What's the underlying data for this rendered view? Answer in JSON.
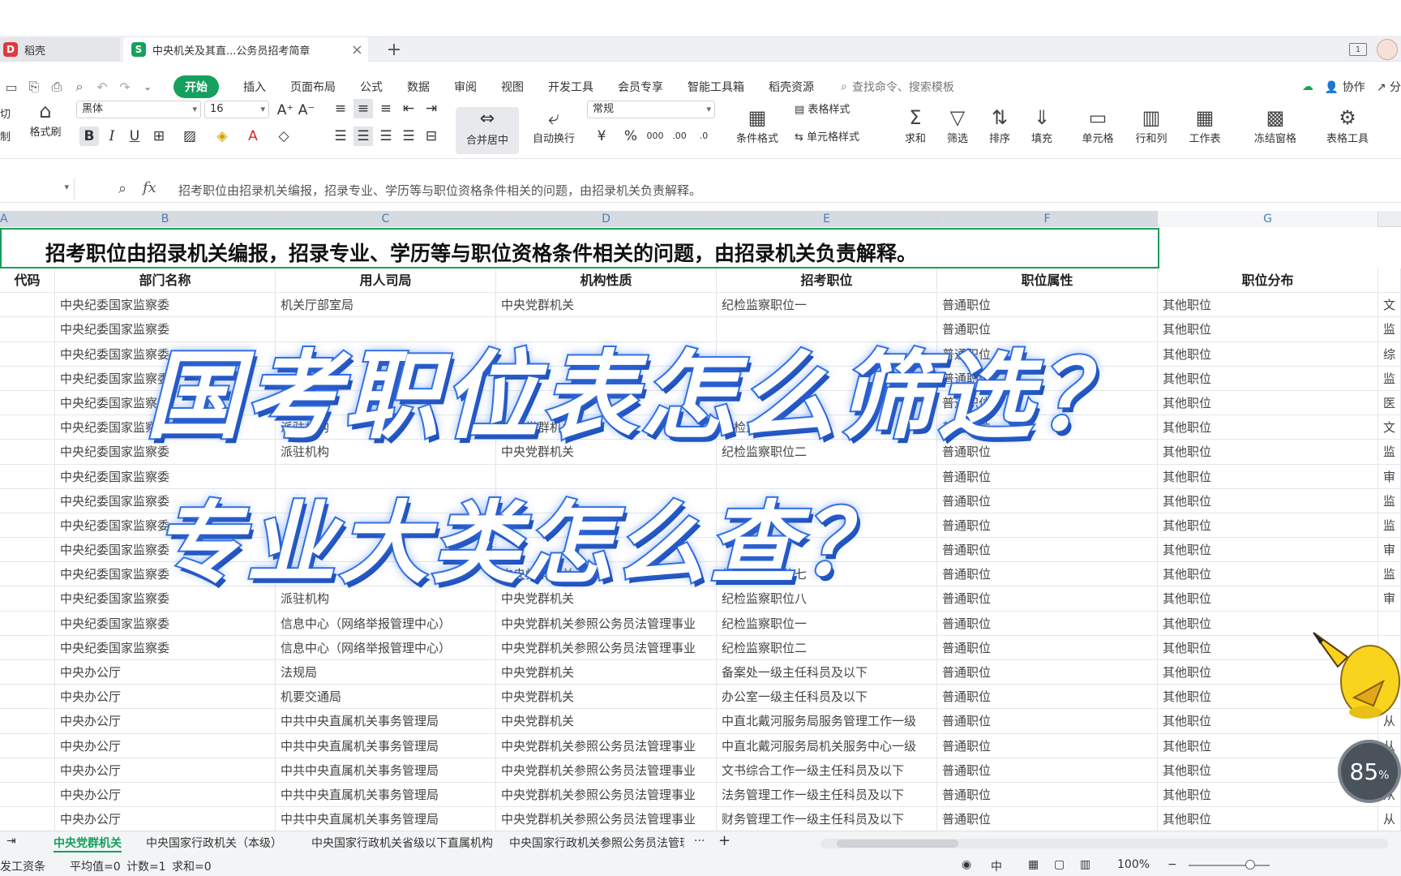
{
  "tabs": {
    "first_label": "稻壳",
    "doc_label": "中央机关及其直...公务员招考简章",
    "close": "×",
    "add": "+"
  },
  "menu": {
    "items": [
      "开始",
      "插入",
      "页面布局",
      "公式",
      "数据",
      "审阅",
      "视图",
      "开发工具",
      "会员专享",
      "智能工具箱",
      "稻壳资源"
    ],
    "search_placeholder": "查找命令、搜索模板",
    "collab": "协作",
    "share": "分"
  },
  "ribbon": {
    "cut": "切",
    "paste_mode": "制",
    "format_painter": "格式刷",
    "font_name": "黑体",
    "font_size": "16",
    "merge_center": "合并居中",
    "auto_wrap": "自动换行",
    "number_format": "常规",
    "conditional_format": "条件格式",
    "table_style": "表格样式",
    "cell_style": "单元格样式",
    "sum": "求和",
    "filter": "筛选",
    "sort": "排序",
    "fill": "填充",
    "cell": "单元格",
    "row_col": "行和列",
    "worksheet": "工作表",
    "freeze": "冻结窗格",
    "table_tools": "表格工具"
  },
  "formula_bar": {
    "fx": "fx",
    "content": "招考职位由招录机关编报，招录专业、学历等与职位资格条件相关的问题，由招录机关负责解释。"
  },
  "columns": [
    "A",
    "B",
    "C",
    "D",
    "E",
    "F",
    "G"
  ],
  "sheet_title": "招考职位由招录机关编报，招录专业、学历等与职位资格条件相关的问题，由招录机关负责解释。",
  "table": {
    "headers": [
      "代码",
      "部门名称",
      "用人司局",
      "机构性质",
      "招考职位",
      "职位属性",
      "职位分布",
      ""
    ],
    "rows": [
      [
        "",
        "中央纪委国家监察委",
        "机关厅部室局",
        "中央党群机关",
        "纪检监察职位一",
        "普通职位",
        "其他职位",
        "文"
      ],
      [
        "",
        "中央纪委国家监察委",
        "",
        "",
        "",
        "普通职位",
        "其他职位",
        "监"
      ],
      [
        "",
        "中央纪委国家监察委",
        "",
        "",
        "",
        "普通职位",
        "其他职位",
        "综"
      ],
      [
        "",
        "中央纪委国家监察委",
        "",
        "",
        "",
        "普通职位",
        "其他职位",
        "监"
      ],
      [
        "",
        "中央纪委国家监察委",
        "派驻机构",
        "",
        "",
        "普通职位",
        "其他职位",
        "医"
      ],
      [
        "",
        "中央纪委国家监察委",
        "派驻机构",
        "中央党群机关",
        "纪检监察职位一",
        "普通职位",
        "其他职位",
        "文"
      ],
      [
        "",
        "中央纪委国家监察委",
        "派驻机构",
        "中央党群机关",
        "纪检监察职位二",
        "普通职位",
        "其他职位",
        "监"
      ],
      [
        "",
        "中央纪委国家监察委",
        "",
        "",
        "",
        "普通职位",
        "其他职位",
        "审"
      ],
      [
        "",
        "中央纪委国家监察委",
        "",
        "",
        "",
        "普通职位",
        "其他职位",
        "监"
      ],
      [
        "",
        "中央纪委国家监察委",
        "",
        "",
        "",
        "普通职位",
        "其他职位",
        "监"
      ],
      [
        "",
        "中央纪委国家监察委",
        "",
        "",
        "",
        "普通职位",
        "其他职位",
        "审"
      ],
      [
        "",
        "中央纪委国家监察委",
        "派驻机构",
        "中央党群机关",
        "纪检监察职位七",
        "普通职位",
        "其他职位",
        "监"
      ],
      [
        "",
        "中央纪委国家监察委",
        "派驻机构",
        "中央党群机关",
        "纪检监察职位八",
        "普通职位",
        "其他职位",
        "审"
      ],
      [
        "",
        "中央纪委国家监察委",
        "信息中心（网络举报管理中心）",
        "中央党群机关参照公务员法管理事业",
        "纪检监察职位一",
        "普通职位",
        "其他职位",
        ""
      ],
      [
        "",
        "中央纪委国家监察委",
        "信息中心（网络举报管理中心）",
        "中央党群机关参照公务员法管理事业",
        "纪检监察职位二",
        "普通职位",
        "其他职位",
        ""
      ],
      [
        "",
        "中央办公厅",
        "法规局",
        "中央党群机关",
        "备案处一级主任科员及以下",
        "普通职位",
        "其他职位",
        "主"
      ],
      [
        "",
        "中央办公厅",
        "机要交通局",
        "中央党群机关",
        "办公室一级主任科员及以下",
        "普通职位",
        "其他职位",
        "从"
      ],
      [
        "",
        "中央办公厅",
        "中共中央直属机关事务管理局",
        "中央党群机关",
        "中直北戴河服务局服务管理工作一级",
        "普通职位",
        "其他职位",
        "从"
      ],
      [
        "",
        "中央办公厅",
        "中共中央直属机关事务管理局",
        "中央党群机关参照公务员法管理事业",
        "中直北戴河服务局机关服务中心一级",
        "普通职位",
        "其他职位",
        "从"
      ],
      [
        "",
        "中央办公厅",
        "中共中央直属机关事务管理局",
        "中央党群机关参照公务员法管理事业",
        "文书综合工作一级主任科员及以下",
        "普通职位",
        "其他职位",
        "从"
      ],
      [
        "",
        "中央办公厅",
        "中共中央直属机关事务管理局",
        "中央党群机关参照公务员法管理事业",
        "法务管理工作一级主任科员及以下",
        "普通职位",
        "其他职位",
        "从"
      ],
      [
        "",
        "中央办公厅",
        "中共中央直属机关事务管理局",
        "中央党群机关参照公务员法管理事业",
        "财务管理工作一级主任科员及以下",
        "普通职位",
        "其他职位",
        "从"
      ]
    ]
  },
  "headline": {
    "line1": "国考职位表怎么筛选？",
    "line2": "专业大类怎么查？"
  },
  "gauge": {
    "value": "85",
    "unit": "%"
  },
  "sheet_tabs": [
    "中央党群机关",
    "中央国家行政机关（本级）",
    "中央国家行政机关省级以下直属机构",
    "中央国家行政机关参照公务员法管理",
    "···",
    "+"
  ],
  "status": {
    "left": "发工资条",
    "average": "平均值=0",
    "count": "计数=1",
    "sum": "求和=0",
    "input_mode": "中",
    "zoom": "100%"
  },
  "colors": {
    "accent_green": "#16a05d",
    "headline_blue": "#2f6fe0"
  }
}
